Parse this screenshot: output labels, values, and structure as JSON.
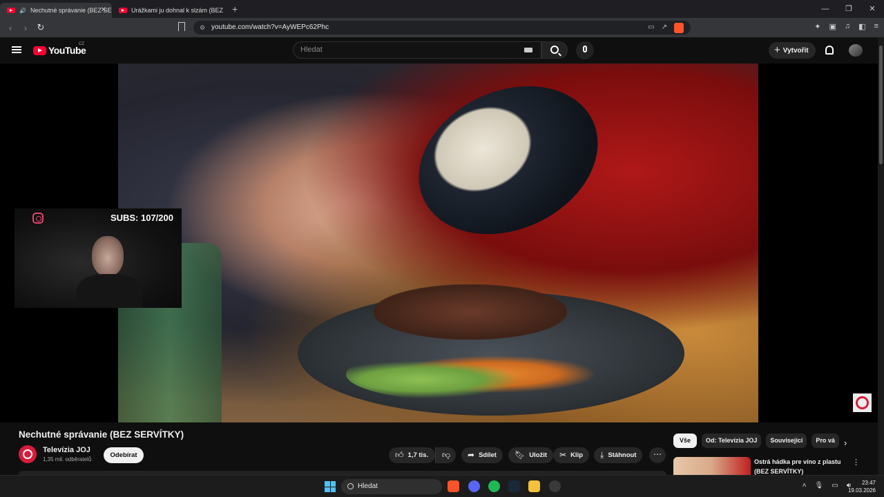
{
  "browser": {
    "tabs": [
      {
        "title": "Nechutné správanie (BEZ SER",
        "active": true
      },
      {
        "title": "Urážkami ju dohnal k slzám (BEZ SER",
        "active": false
      }
    ],
    "new_tab": "+",
    "url": "youtube.com/watch?v=AyWEPc62Phc"
  },
  "header": {
    "logo_text": "YouTube",
    "country_code": "CZ",
    "search_placeholder": "Hledat",
    "create_label": "Vytvořit"
  },
  "overlay": {
    "subs_counter": "SUBS: 107/200"
  },
  "video": {
    "title": "Nechutné správanie (BEZ SERVÍTKY)",
    "channel_name": "Televízia JOJ",
    "channel_subs": "1,35 mil. odběratelů",
    "subscribe_label": "Odebírat",
    "actions": {
      "likes": "1,7 tis.",
      "share": "Sdílet",
      "save": "Uložit",
      "clip": "Klip",
      "download": "Stáhnout"
    }
  },
  "sidebar": {
    "chips": [
      "Vše",
      "Od: Televízia JOJ",
      "Související",
      "Pro vá"
    ],
    "recommendation": {
      "title": "Ostrá hádka pre víno z plastu (BEZ SERVÍTKY)"
    }
  },
  "taskbar": {
    "search_label": "Hledat",
    "time": "23:47",
    "date": "19.03.2026"
  },
  "colors": {
    "yt_red": "#ff0033",
    "bg": "#0f0f0f",
    "joj_red": "#d81b3a"
  }
}
